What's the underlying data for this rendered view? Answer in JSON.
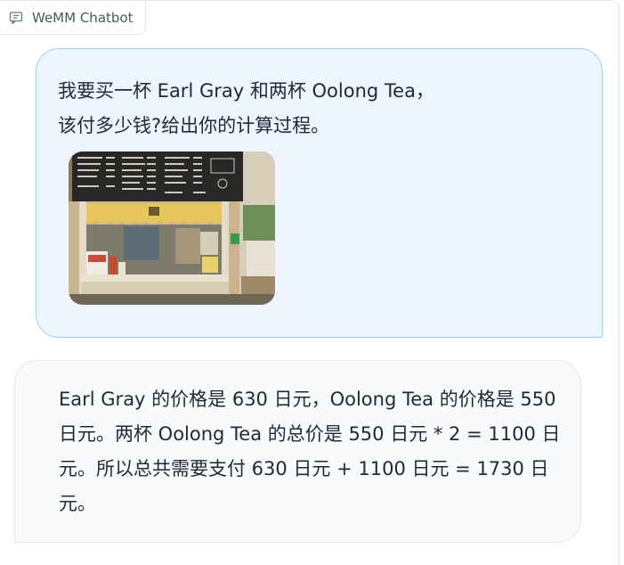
{
  "app": {
    "label": "WeMM Chatbot",
    "icon": "chat-icon"
  },
  "messages": [
    {
      "role": "user",
      "text": "我要买一杯 Earl Gray 和两杯 Oolong Tea，\n该付多少钱?给出你的计算过程。",
      "image": {
        "description": "photo of a tea shop counter with a chalkboard drink menu",
        "menu_items": [
          "Jasmine Tea",
          "Oolong Tea",
          "Earl Gray",
          "Gray Apple",
          "Blood Orange",
          "Lemon Tea",
          "Matcha Latte",
          "Coco Latte",
          "Green Milk",
          "Yuzu Tea",
          "Honey Ginger",
          "Cocoa Drink",
          "Coco Soda",
          "Chocolate"
        ]
      }
    },
    {
      "role": "bot",
      "text": "Earl Gray 的价格是 630 日元，Oolong Tea 的价格是 550 日元。两杯 Oolong Tea 的总价是 550 日元 * 2 = 1100 日元。所以总共需要支付 630 日元 + 1100 日元 = 1730 日元。"
    }
  ],
  "colors": {
    "user_bubble_bg": "#eef5ff",
    "user_bubble_border": "#a3cdec",
    "bot_bubble_bg": "#f8fafc",
    "bot_bubble_border": "#e5e7eb"
  }
}
